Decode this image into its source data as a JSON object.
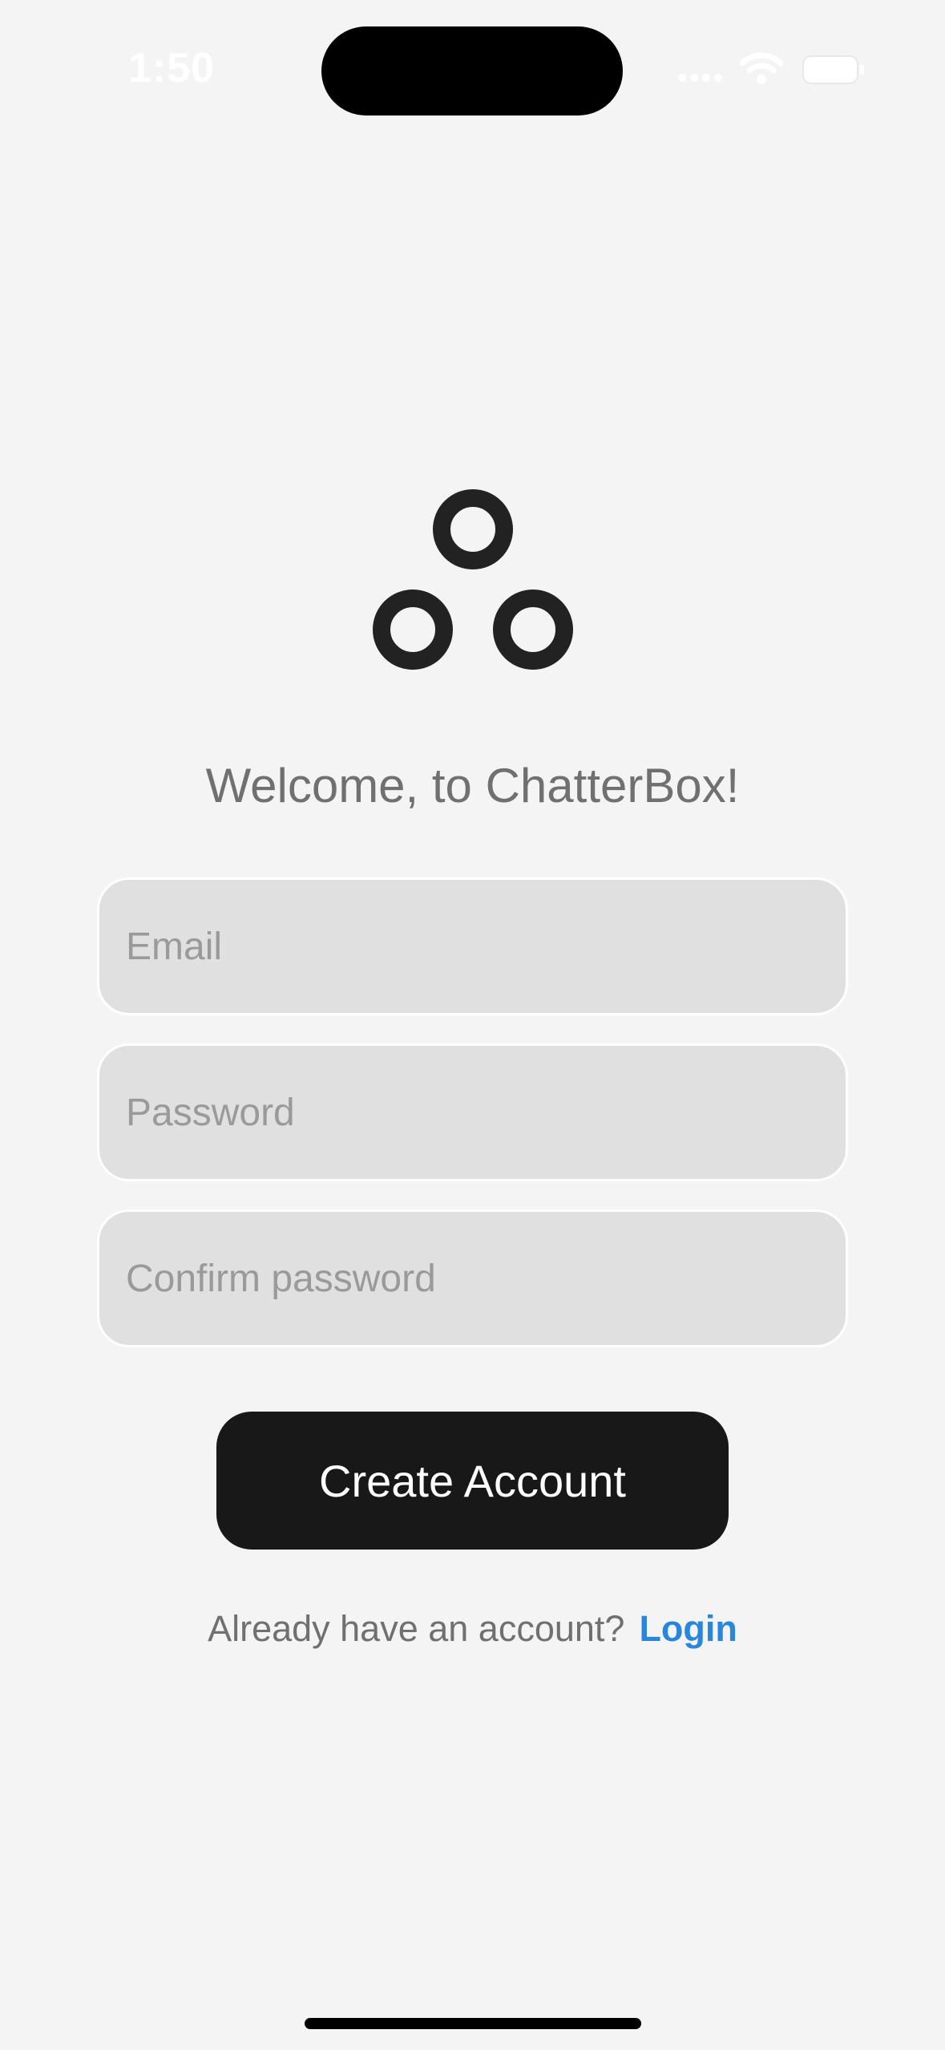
{
  "status_bar": {
    "time": "1:50"
  },
  "welcome_text": "Welcome, to ChatterBox!",
  "form": {
    "email_placeholder": "Email",
    "password_placeholder": "Password",
    "confirm_password_placeholder": "Confirm password",
    "create_button_label": "Create Account"
  },
  "footer": {
    "prompt": "Already have an account?",
    "login_label": "Login"
  },
  "icons": {
    "logo": "three-circles-logo-icon",
    "signal": "cellular-signal-icon",
    "wifi": "wifi-icon",
    "battery": "battery-icon"
  },
  "colors": {
    "background": "#f4f4f4",
    "button": "#181818",
    "link": "#2a86dc",
    "field": "#e0e0e0"
  }
}
